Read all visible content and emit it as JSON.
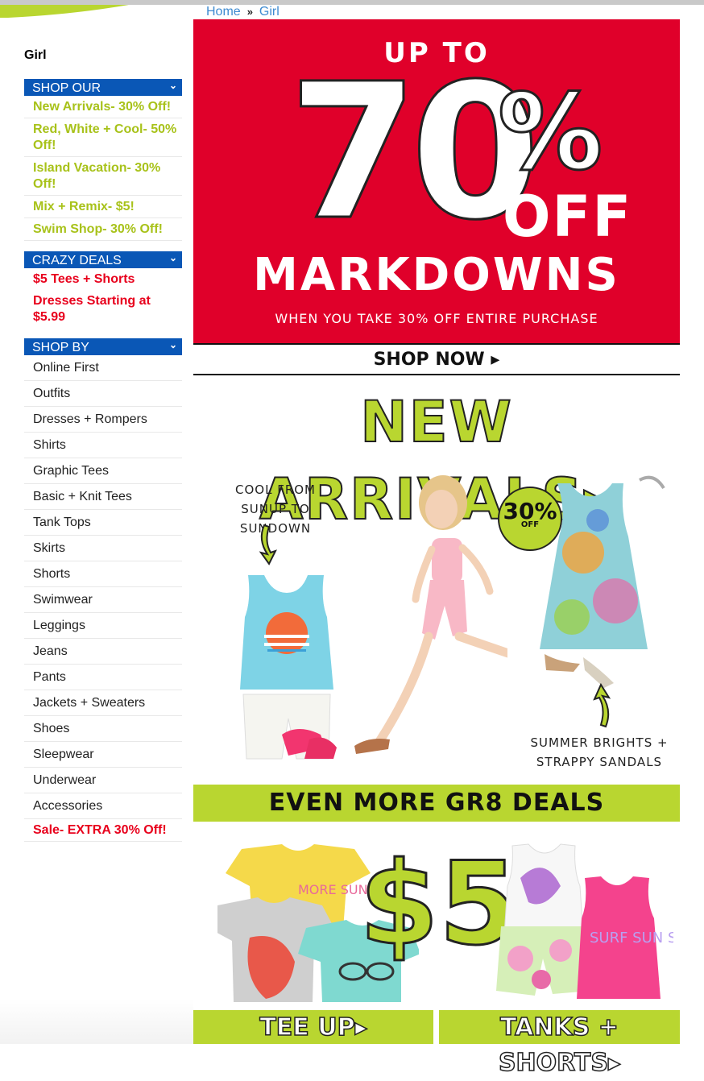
{
  "breadcrumb": {
    "home": "Home",
    "separator": "»",
    "current": "Girl"
  },
  "sidebar": {
    "title": "Girl",
    "shop_our": {
      "heading": "SHOP OUR",
      "items": [
        "New Arrivals- 30% Off!",
        "Red, White + Cool- 50% Off!",
        "Island Vacation- 30% Off!",
        "Mix + Remix- $5!",
        "Swim Shop- 30% Off!"
      ]
    },
    "crazy_deals": {
      "heading": "CRAZY DEALS",
      "items": [
        "$5 Tees + Shorts",
        "Dresses Starting at $5.99"
      ]
    },
    "shop_by": {
      "heading": "SHOP BY",
      "items": [
        "Online First",
        "Outfits",
        "Dresses + Rompers",
        "Shirts",
        "Graphic Tees",
        "Basic + Knit Tees",
        "Tank Tops",
        "Skirts",
        "Shorts",
        "Swimwear",
        "Leggings",
        "Jeans",
        "Pants",
        "Jackets + Sweaters",
        "Shoes",
        "Sleepwear",
        "Underwear",
        "Accessories"
      ],
      "sale": "Sale- EXTRA 30% Off!"
    }
  },
  "banner": {
    "up_to": "UP TO",
    "percent_number": "70",
    "percent_sign": "%",
    "off": "OFF",
    "headline": "MARKDOWNS",
    "subline": "WHEN YOU TAKE 30% OFF ENTIRE PURCHASE",
    "shop_now": "SHOP NOW ▸"
  },
  "new_arrivals": {
    "heading": "NEW ARRIVALS▸",
    "caption_left_1": "COOL FROM",
    "caption_left_2": "SUNUP TO SUNDOWN",
    "badge": "30%",
    "badge_small": "OFF",
    "caption_right_1": "SUMMER BRIGHTS +",
    "caption_right_2": "STRAPPY SANDALS"
  },
  "deals": {
    "heading": "EVEN MORE GR8 DEALS",
    "price": "$5",
    "tee_text": "MORE SUN",
    "tank_text": "SURF SUN SAND",
    "tee_up": "TEE UP▸",
    "tanks_shorts": "TANKS + SHORTS▸"
  },
  "colors": {
    "nav_blue": "#0a57b6",
    "promo_green": "#a8c21a",
    "lime": "#b9d630",
    "deal_red": "#e8001c",
    "banner_red": "#e0002a"
  }
}
